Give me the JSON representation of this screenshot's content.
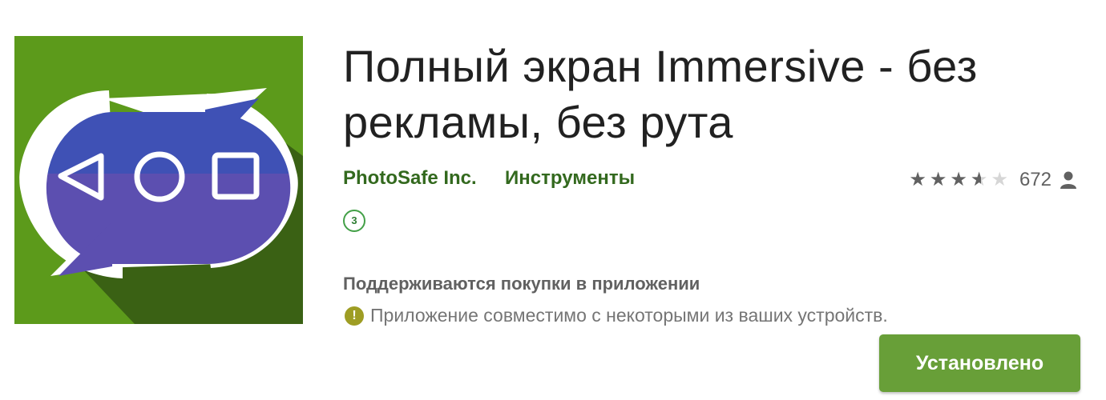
{
  "app": {
    "title": "Полный экран Immersive - без рекламы, без рута",
    "developer": "PhotoSafe Inc.",
    "category": "Инструменты",
    "content_rating": "3",
    "rating": {
      "stars": 3.5,
      "max_stars": 5,
      "count": "672"
    },
    "in_app_purchases": "Поддерживаются покупки в приложении",
    "compatibility": "Приложение совместимо с некоторыми из ваших устройств.",
    "install_label": "Установлено"
  },
  "icons": {
    "app_icon": "immersive-app-icon",
    "rating_user": "person-icon",
    "compat_info": "info-icon",
    "info_glyph": "!"
  },
  "colors": {
    "icon_background": "#5c9a1b",
    "icon_shadow": "#3a6114",
    "icon_pill_top": "#3f51b5",
    "icon_pill_bottom": "#5c4fb0",
    "link_green": "#33691e",
    "install_button": "#689f38",
    "star_filled": "#616161",
    "star_empty": "#d6d6d6"
  }
}
